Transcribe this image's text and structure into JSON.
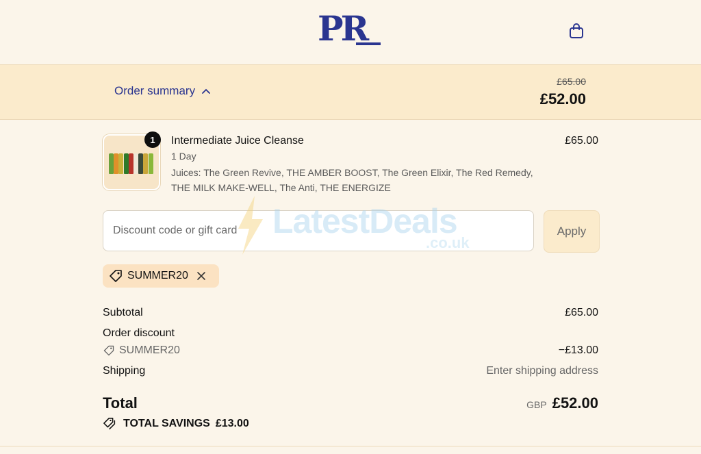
{
  "header": {
    "logo_text": "PR",
    "cart_icon": "shopping-bag-icon"
  },
  "summary": {
    "toggle_label": "Order summary",
    "toggle_icon": "chevron-up-icon",
    "original_total": "£65.00",
    "total": "£52.00"
  },
  "product": {
    "quantity": "1",
    "name": "Intermediate Juice Cleanse",
    "variant": "1 Day",
    "description": "Juices: The Green Revive, THE AMBER BOOST, The Green Elixir, The Red Remedy, THE MILK MAKE-WELL, The Anti, THE ENERGIZE",
    "price": "£65.00",
    "bottle_colors": [
      "#6aa13a",
      "#e0902a",
      "#c8b23a",
      "#2f7a2a",
      "#b8342a",
      "#efe7d6",
      "#3a4a3a",
      "#c9a63a",
      "#8ab83a"
    ]
  },
  "discount": {
    "placeholder": "Discount code or gift card",
    "apply_label": "Apply",
    "applied_code": "SUMMER20"
  },
  "watermark": {
    "brand": "LatestDeals",
    "domain": ".co.uk"
  },
  "breakdown": {
    "subtotal_label": "Subtotal",
    "subtotal_value": "£65.00",
    "order_discount_label": "Order discount",
    "order_discount_code": "SUMMER20",
    "order_discount_value": "−£13.00",
    "shipping_label": "Shipping",
    "shipping_value": "Enter shipping address",
    "total_label": "Total",
    "total_currency": "GBP",
    "total_value": "£52.00",
    "savings_label": "TOTAL SAVINGS",
    "savings_value": "£13.00"
  },
  "colors": {
    "brand": "#2a3590",
    "summary_bg": "#fbebcc",
    "page_bg": "#fbf5ea"
  }
}
